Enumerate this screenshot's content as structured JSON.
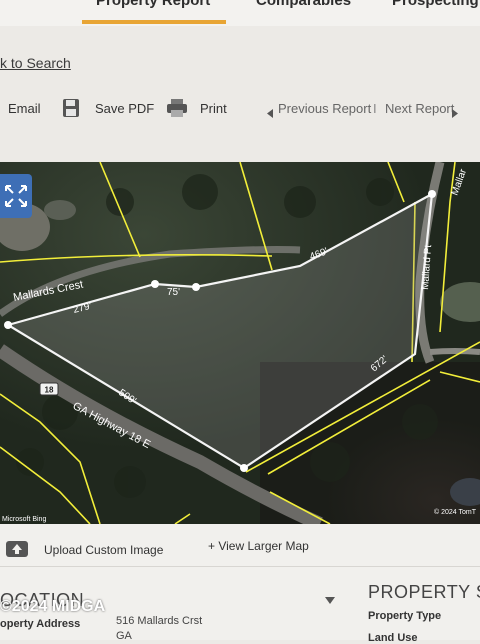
{
  "tabs": [
    {
      "label": "Property Report",
      "active": true
    },
    {
      "label": "Comparables",
      "active": false
    },
    {
      "label": "Prospecting",
      "active": false
    }
  ],
  "back_link": "k to Search",
  "toolbar": {
    "email": "Email",
    "save_pdf": "Save PDF",
    "print": "Print",
    "previous": "Previous Report",
    "separator": "I",
    "next": "Next Report"
  },
  "map": {
    "road_labels": {
      "mallards_crest": "Mallards Crest",
      "ga_highway": "GA Highway 18 E",
      "mallard_pt": "Mallard Pt",
      "mallard_pt_top": "Mallar",
      "route_shield": "18"
    },
    "dimensions": [
      "279'",
      "75'",
      "469'",
      "672'",
      "509'"
    ],
    "attribution_left": "Microsoft Bing",
    "attribution_right": "© 2024 TomT",
    "colors": {
      "parcel_line": "#f2ee3a",
      "outline": "#f4f4f4",
      "expand_button": "#3e6fb6"
    }
  },
  "actions": {
    "upload": "Upload Custom Image",
    "larger_map": "+ View Larger Map"
  },
  "location": {
    "title": "OCATION",
    "address_label": "operty Address",
    "address_value": "516 Mallards Crst",
    "state": "GA"
  },
  "property": {
    "title": "PROPERTY S",
    "type_label": "Property Type",
    "land_use_label": "Land Use"
  },
  "watermark": "©2024 MIDGA"
}
